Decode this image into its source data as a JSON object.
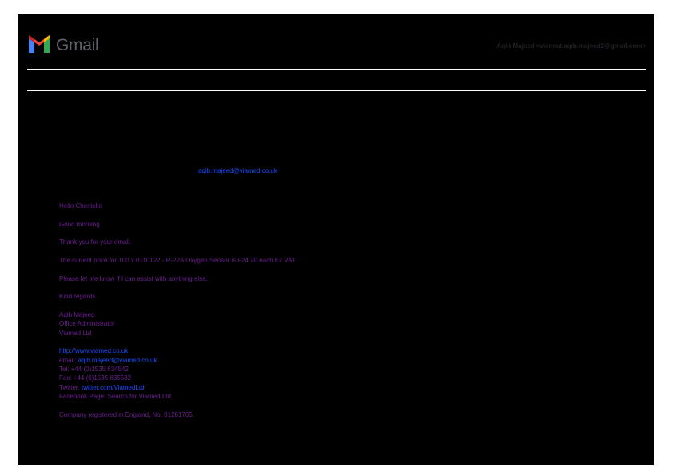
{
  "app": {
    "logo_text": "Gmail"
  },
  "account": "Aqib Majeed <viamed.aqib.majeed2@gmail.com>",
  "recipient_email": "aqib.majeed@viamed.co.uk",
  "message": {
    "greeting": "Hello Chenielle",
    "good_morning": "Good morning",
    "thanks": "Thank you for your email.",
    "price_line": "The current price for 100 x 0110122 - R-22A Oxygen Sensor is £24.20 each Ex VAT.",
    "help_line": "Please let me know if I can assist with anything else.",
    "sign_off": "Kind regards",
    "signature": {
      "name": "Aqib Majeed",
      "title": "Office Administrator",
      "company": "Viamed Ltd",
      "website": "http://www.viamed.co.uk",
      "email_label": "email: ",
      "email": "aqib.majeed@viamed.co.uk",
      "tel": "Tel: +44 (0)1535 634542",
      "fax": "Fax: +44 (0)1535 635582",
      "twitter_label": "Twitter: ",
      "twitter": "twitter.com/ViamedLtd",
      "facebook": "Facebook Page: Search for Viamed Ltd",
      "registration": "Company registered in England, No. 01281765."
    }
  },
  "colors": {
    "background": "#000000",
    "text": "#6b1e8f",
    "link": "#1a4cff",
    "logo_red": "#ea4335",
    "logo_blue": "#4285f4",
    "logo_green": "#34a853",
    "logo_yellow": "#fbbc04"
  }
}
